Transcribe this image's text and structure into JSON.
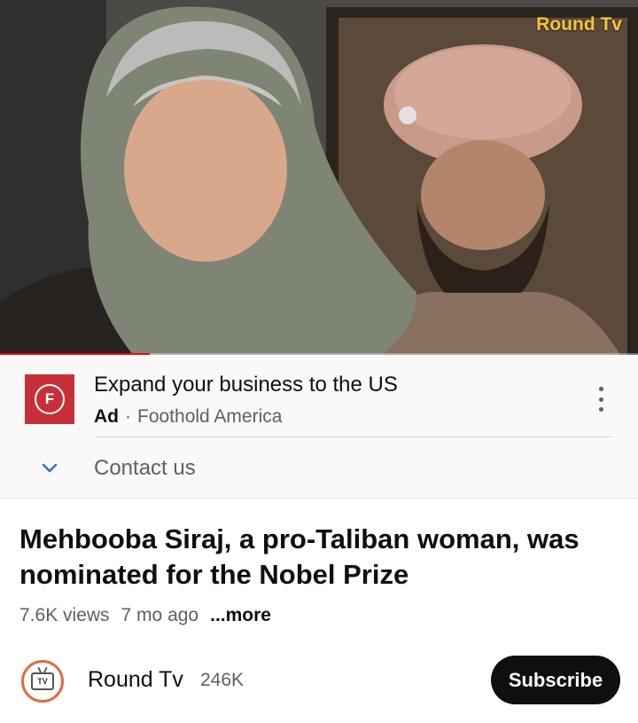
{
  "player": {
    "watermark": "Round Tv",
    "progress_fraction": 0.235,
    "progress_color": "#ff0000"
  },
  "ad": {
    "logo_letter": "F",
    "logo_color": "#c7303a",
    "title": "Expand your business to the US",
    "badge": "Ad",
    "separator": "·",
    "advertiser": "Foothold America",
    "menu_icon": "more-vert-icon",
    "expand_icon": "chevron-down-icon",
    "cta": "Contact us"
  },
  "video": {
    "title": "Mehbooba Siraj, a pro-Taliban woman, was nominated for the Nobel Prize",
    "views": "7.6K views",
    "age": "7 mo ago",
    "more": "...more"
  },
  "channel": {
    "avatar_text": "TV",
    "name": "Round Tv",
    "subscribers": "246K",
    "subscribe_label": "Subscribe"
  }
}
